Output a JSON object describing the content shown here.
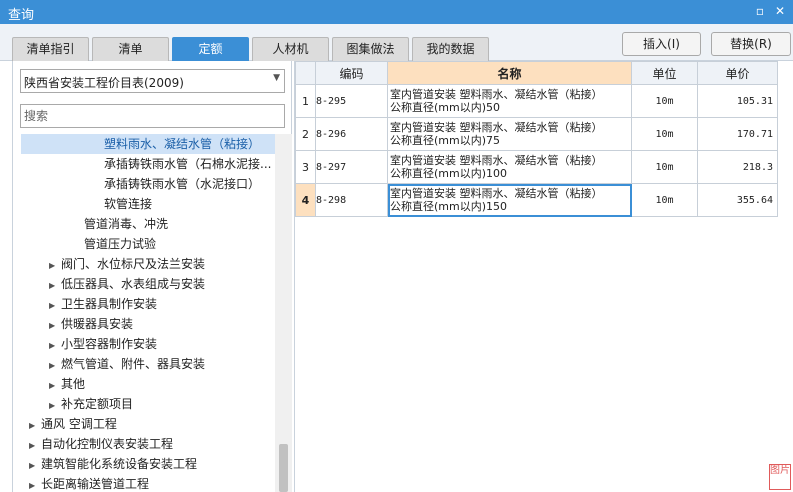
{
  "window": {
    "title": "查询",
    "restore_glyph": "▫",
    "close_glyph": "✕"
  },
  "tabs": [
    {
      "label": "清单指引"
    },
    {
      "label": "清单"
    },
    {
      "label": "定额",
      "active": true
    },
    {
      "label": "人材机"
    },
    {
      "label": "图集做法"
    },
    {
      "label": "我的数据"
    }
  ],
  "actions": {
    "insert_label": "插入(I)",
    "replace_label": "替换(R)"
  },
  "left": {
    "library_select": "陕西省安装工程价目表(2009)",
    "search_placeholder": "搜索",
    "tree": [
      {
        "label": "塑料雨水、凝结水管（粘接）",
        "selected": true,
        "toggle": ""
      },
      {
        "label": "承插铸铁雨水管（石棉水泥接...",
        "toggle": ""
      },
      {
        "label": "承插铸铁雨水管（水泥接口）",
        "toggle": ""
      },
      {
        "label": "软管连接",
        "toggle": ""
      },
      {
        "label": "管道消毒、冲洗",
        "toggle": ""
      },
      {
        "label": "管道压力试验",
        "toggle": ""
      },
      {
        "label": "阀门、水位标尺及法兰安装",
        "toggle": "▶"
      },
      {
        "label": "低压器具、水表组成与安装",
        "toggle": "▶"
      },
      {
        "label": "卫生器具制作安装",
        "toggle": "▶"
      },
      {
        "label": "供暖器具安装",
        "toggle": "▶"
      },
      {
        "label": "小型容器制作安装",
        "toggle": "▶"
      },
      {
        "label": "燃气管道、附件、器具安装",
        "toggle": "▶"
      },
      {
        "label": "其他",
        "toggle": "▶"
      },
      {
        "label": "补充定额项目",
        "toggle": "▶"
      },
      {
        "label": "通风 空调工程",
        "toggle": "▶"
      },
      {
        "label": "自动化控制仪表安装工程",
        "toggle": "▶"
      },
      {
        "label": "建筑智能化系统设备安装工程",
        "toggle": "▶"
      },
      {
        "label": "长距离输送管道工程",
        "toggle": "▶"
      }
    ]
  },
  "table": {
    "columns": [
      "编码",
      "名称",
      "单位",
      "单价"
    ],
    "rows": [
      {
        "num": "1",
        "code": "8-295",
        "name_line1": "室内管道安装 塑料雨水、凝结水管（粘接）",
        "name_line2": "公称直径(mm以内)50",
        "unit": "10m",
        "price": "105.31"
      },
      {
        "num": "2",
        "code": "8-296",
        "name_line1": "室内管道安装 塑料雨水、凝结水管（粘接）",
        "name_line2": "公称直径(mm以内)75",
        "unit": "10m",
        "price": "170.71"
      },
      {
        "num": "3",
        "code": "8-297",
        "name_line1": "室内管道安装 塑料雨水、凝结水管（粘接）",
        "name_line2": "公称直径(mm以内)100",
        "unit": "10m",
        "price": "218.3"
      },
      {
        "num": "4",
        "code": "8-298",
        "name_line1": "室内管道安装 塑料雨水、凝结水管（粘接）",
        "name_line2": "公称直径(mm以内)150",
        "unit": "10m",
        "price": "355.64",
        "current": true
      }
    ]
  },
  "watermark": {
    "text": "图片"
  },
  "colors": {
    "accent": "#3b8fd6",
    "header_highlight": "#fde0bf",
    "selection": "#cfe2f7"
  }
}
